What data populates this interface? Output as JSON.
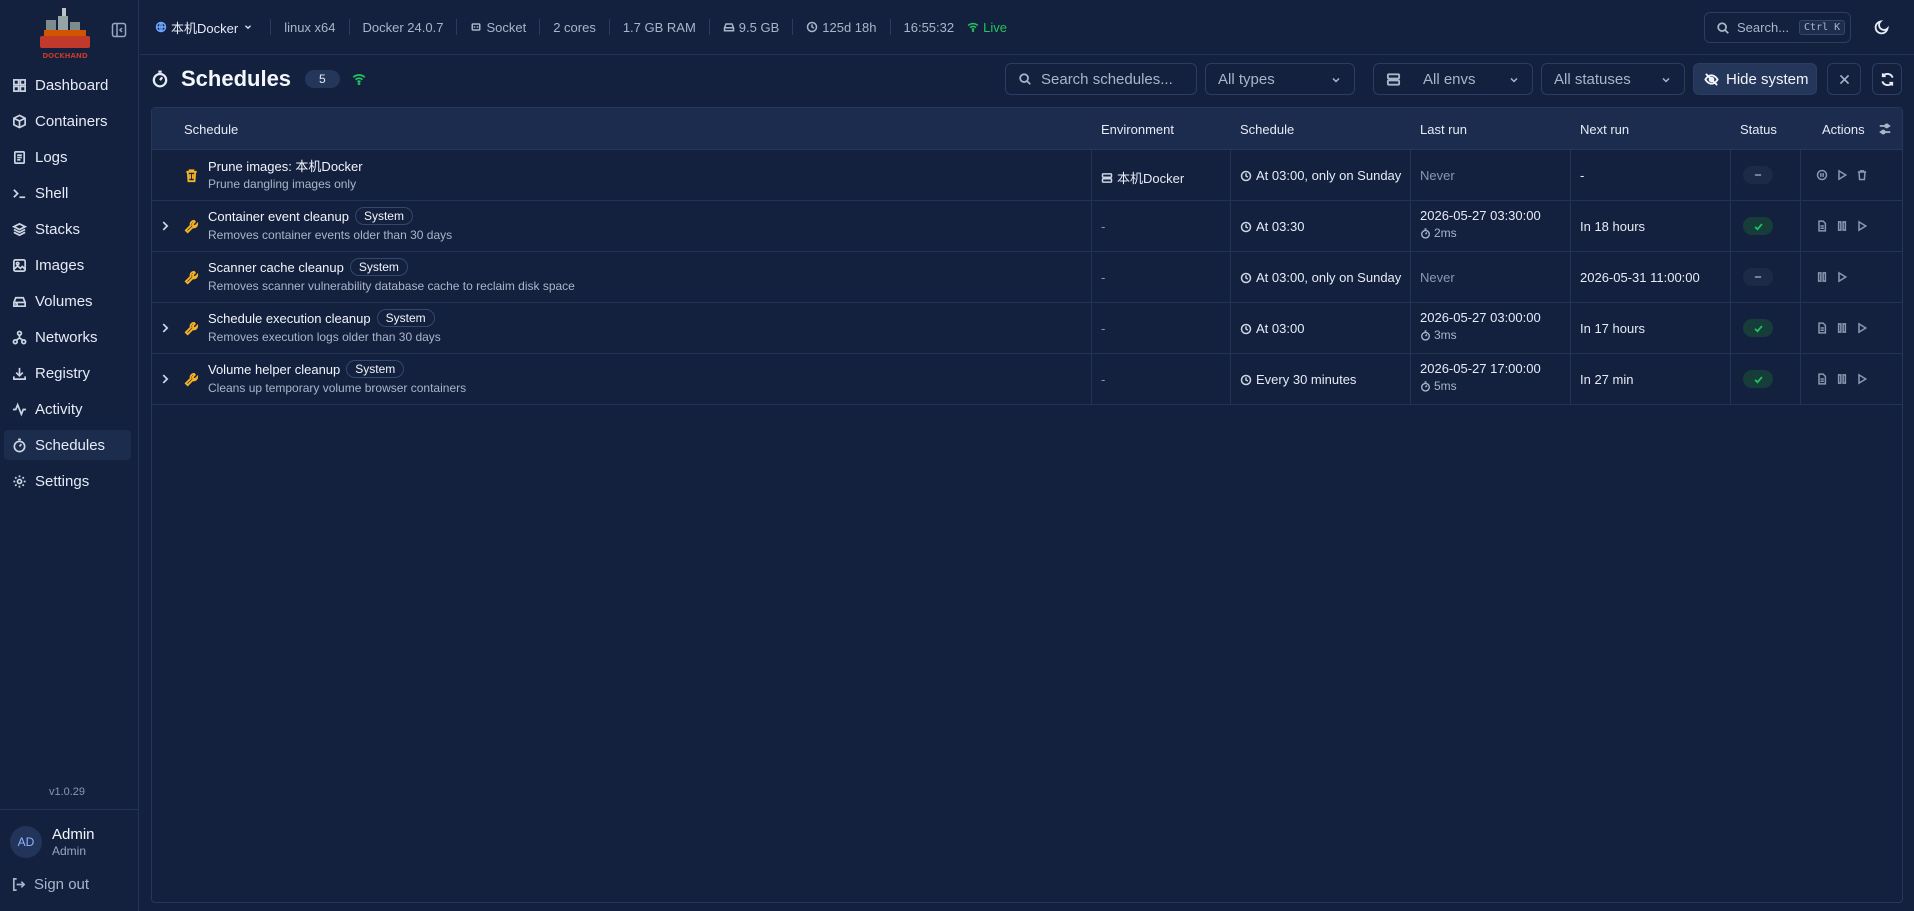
{
  "brand": {
    "logo_text": "DOCKHAND",
    "version": "v1.0.29"
  },
  "topbar": {
    "env": "本机Docker",
    "platform": "linux x64",
    "docker": "Docker 24.0.7",
    "connection": "Socket",
    "cores": "2 cores",
    "ram": "1.7 GB RAM",
    "disk": "9.5 GB",
    "uptime": "125d 18h",
    "clock": "16:55:32",
    "live": "Live",
    "search_placeholder": "Search...",
    "search_kbd": "Ctrl K"
  },
  "sidebar": {
    "items": [
      {
        "label": "Dashboard",
        "icon": "dashboard-icon"
      },
      {
        "label": "Containers",
        "icon": "box-icon"
      },
      {
        "label": "Logs",
        "icon": "logs-icon"
      },
      {
        "label": "Shell",
        "icon": "terminal-icon"
      },
      {
        "label": "Stacks",
        "icon": "layers-icon"
      },
      {
        "label": "Images",
        "icon": "image-icon"
      },
      {
        "label": "Volumes",
        "icon": "hard-drive-icon"
      },
      {
        "label": "Networks",
        "icon": "network-icon"
      },
      {
        "label": "Registry",
        "icon": "download-icon"
      },
      {
        "label": "Activity",
        "icon": "activity-icon"
      },
      {
        "label": "Schedules",
        "icon": "timer-icon"
      },
      {
        "label": "Settings",
        "icon": "gear-icon"
      }
    ],
    "active": "Schedules"
  },
  "user": {
    "initials": "AD",
    "name": "Admin",
    "role": "Admin",
    "signout": "Sign out"
  },
  "page": {
    "title": "Schedules",
    "count": "5",
    "search_placeholder": "Search schedules...",
    "filter_types": "All types",
    "filter_envs": "All envs",
    "filter_statuses": "All statuses",
    "hide_system": "Hide system"
  },
  "table": {
    "headers": {
      "schedule": "Schedule",
      "environment": "Environment",
      "schedule2": "Schedule",
      "last_run": "Last run",
      "next_run": "Next run",
      "status": "Status",
      "actions": "Actions"
    },
    "rows": [
      {
        "name": "Prune images: 本机Docker",
        "badge": "",
        "desc": "Prune dangling images only",
        "env": "本机Docker",
        "schedule": "At 03:00, only on Sunday",
        "last_run": "Never",
        "duration": "",
        "next_run": "-",
        "status": "none",
        "icon": "trash-icon",
        "expandable": false
      },
      {
        "name": "Container event cleanup",
        "badge": "System",
        "desc": "Removes container events older than 30 days",
        "env": "-",
        "schedule": "At 03:30",
        "last_run": "2026-05-27 03:30:00",
        "duration": "2ms",
        "next_run": "In 18 hours",
        "status": "ok",
        "icon": "wrench-icon",
        "expandable": true
      },
      {
        "name": "Scanner cache cleanup",
        "badge": "System",
        "desc": "Removes scanner vulnerability database cache to reclaim disk space",
        "env": "-",
        "schedule": "At 03:00, only on Sunday",
        "last_run": "Never",
        "duration": "",
        "next_run": "2026-05-31 11:00:00",
        "status": "none",
        "icon": "wrench-icon",
        "expandable": false
      },
      {
        "name": "Schedule execution cleanup",
        "badge": "System",
        "desc": "Removes execution logs older than 30 days",
        "env": "-",
        "schedule": "At 03:00",
        "last_run": "2026-05-27 03:00:00",
        "duration": "3ms",
        "next_run": "In 17 hours",
        "status": "ok",
        "icon": "wrench-icon",
        "expandable": true
      },
      {
        "name": "Volume helper cleanup",
        "badge": "System",
        "desc": "Cleans up temporary volume browser containers",
        "env": "-",
        "schedule": "Every 30 minutes",
        "last_run": "2026-05-27 17:00:00",
        "duration": "5ms",
        "next_run": "In 27 min",
        "status": "ok",
        "icon": "wrench-icon",
        "expandable": true
      }
    ]
  },
  "colors": {
    "accent_green": "#22c55e",
    "warning": "#f5b324",
    "background": "#13213f"
  }
}
